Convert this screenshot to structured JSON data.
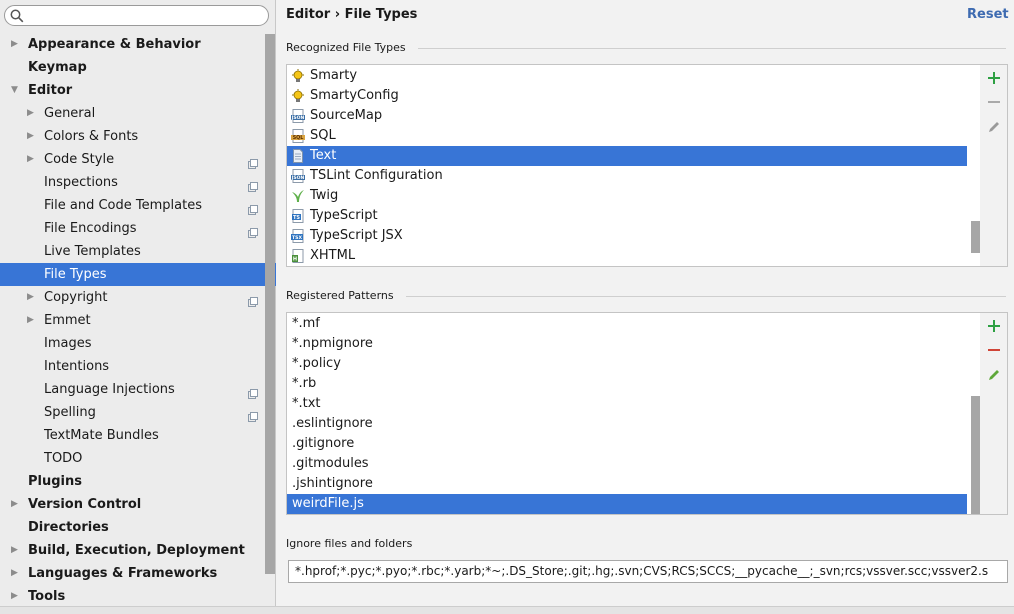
{
  "search": {
    "placeholder": ""
  },
  "sidebar": {
    "items": [
      {
        "label": "Appearance & Behavior",
        "level": 0,
        "arrow": "right",
        "copy": false
      },
      {
        "label": "Keymap",
        "level": 0,
        "arrow": "",
        "copy": false
      },
      {
        "label": "Editor",
        "level": 0,
        "arrow": "down",
        "copy": false
      },
      {
        "label": "General",
        "level": 1,
        "arrow": "right",
        "copy": false
      },
      {
        "label": "Colors & Fonts",
        "level": 1,
        "arrow": "right",
        "copy": false
      },
      {
        "label": "Code Style",
        "level": 1,
        "arrow": "right",
        "copy": true
      },
      {
        "label": "Inspections",
        "level": 1,
        "arrow": "",
        "copy": true
      },
      {
        "label": "File and Code Templates",
        "level": 1,
        "arrow": "",
        "copy": true
      },
      {
        "label": "File Encodings",
        "level": 1,
        "arrow": "",
        "copy": true
      },
      {
        "label": "Live Templates",
        "level": 1,
        "arrow": "",
        "copy": false
      },
      {
        "label": "File Types",
        "level": 1,
        "arrow": "",
        "copy": false,
        "selected": true
      },
      {
        "label": "Copyright",
        "level": 1,
        "arrow": "right",
        "copy": true
      },
      {
        "label": "Emmet",
        "level": 1,
        "arrow": "right",
        "copy": false
      },
      {
        "label": "Images",
        "level": 1,
        "arrow": "",
        "copy": false
      },
      {
        "label": "Intentions",
        "level": 1,
        "arrow": "",
        "copy": false
      },
      {
        "label": "Language Injections",
        "level": 1,
        "arrow": "",
        "copy": true
      },
      {
        "label": "Spelling",
        "level": 1,
        "arrow": "",
        "copy": true
      },
      {
        "label": "TextMate Bundles",
        "level": 1,
        "arrow": "",
        "copy": false
      },
      {
        "label": "TODO",
        "level": 1,
        "arrow": "",
        "copy": false
      },
      {
        "label": "Plugins",
        "level": 0,
        "arrow": "",
        "copy": false
      },
      {
        "label": "Version Control",
        "level": 0,
        "arrow": "right",
        "copy": false
      },
      {
        "label": "Directories",
        "level": 0,
        "arrow": "",
        "copy": false
      },
      {
        "label": "Build, Execution, Deployment",
        "level": 0,
        "arrow": "right",
        "copy": false
      },
      {
        "label": "Languages & Frameworks",
        "level": 0,
        "arrow": "right",
        "copy": false
      },
      {
        "label": "Tools",
        "level": 0,
        "arrow": "right",
        "copy": false
      }
    ]
  },
  "header": {
    "breadcrumb": "Editor › File Types",
    "reset_label": "Reset"
  },
  "recognized": {
    "label": "Recognized File Types",
    "items": [
      {
        "label": "Smarty",
        "icon": "bulb-icon"
      },
      {
        "label": "SmartyConfig",
        "icon": "bulb-icon"
      },
      {
        "label": "SourceMap",
        "icon": "json-file-icon"
      },
      {
        "label": "SQL",
        "icon": "sql-file-icon"
      },
      {
        "label": "Text",
        "icon": "text-file-icon",
        "selected": true
      },
      {
        "label": "TSLint Configuration",
        "icon": "json-file-icon"
      },
      {
        "label": "Twig",
        "icon": "twig-icon"
      },
      {
        "label": "TypeScript",
        "icon": "ts-file-icon"
      },
      {
        "label": "TypeScript JSX",
        "icon": "tsx-file-icon"
      },
      {
        "label": "XHTML",
        "icon": "xhtml-file-icon"
      }
    ]
  },
  "patterns": {
    "label": "Registered Patterns",
    "items": [
      {
        "label": "*.mf"
      },
      {
        "label": "*.npmignore"
      },
      {
        "label": "*.policy"
      },
      {
        "label": "*.rb"
      },
      {
        "label": "*.txt"
      },
      {
        "label": ".eslintignore"
      },
      {
        "label": ".gitignore"
      },
      {
        "label": ".gitmodules"
      },
      {
        "label": ".jshintignore"
      },
      {
        "label": "weirdFile.js",
        "selected": true
      }
    ]
  },
  "ignore": {
    "label": "Ignore files and folders",
    "value": "*.hprof;*.pyc;*.pyo;*.rbc;*.yarb;*~;.DS_Store;.git;.hg;.svn;CVS;RCS;SCCS;__pycache__;_svn;rcs;vssver.scc;vssver2.s"
  },
  "colors": {
    "selection": "#3875d6",
    "add": "#2ea043",
    "remove": "#d04437",
    "edit": "#5fa83a",
    "link": "#3e6bb1"
  }
}
